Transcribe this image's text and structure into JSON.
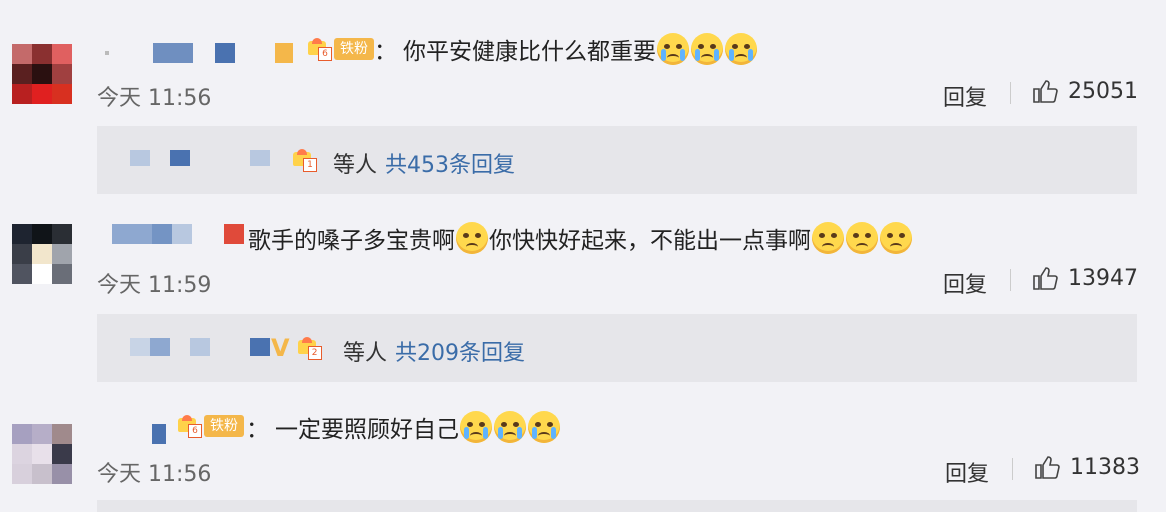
{
  "colors": {
    "link": "#3a6ca8",
    "badge": "#f4b74a",
    "bg": "#f2f2f6",
    "thread_bg": "#e6e6ea"
  },
  "comments": [
    {
      "badge_level": "6",
      "badge_label": "铁粉",
      "separator": "：",
      "text": "你平安健康比什么都重要",
      "emojis": [
        "cry-face",
        "cry-face",
        "cry-face"
      ],
      "time": "今天 11:56",
      "reply_label": "回复",
      "likes": "25051",
      "thread": {
        "badge_level": "1",
        "who": "等人",
        "summary": "共453条回复"
      }
    },
    {
      "text_a": "歌手的嗓子多宝贵啊",
      "text_b": "你快快好起来，不能出一点事啊",
      "emojis": [
        "pleading-face",
        "pleading-face",
        "pleading-face",
        "pleading-face"
      ],
      "time": "今天 11:59",
      "reply_label": "回复",
      "likes": "13947",
      "thread": {
        "badge_level": "2",
        "who": "等人",
        "summary": "共209条回复"
      }
    },
    {
      "badge_level": "6",
      "badge_label": "铁粉",
      "separator": "：",
      "text": "一定要照顾好自己",
      "emojis": [
        "sob-face",
        "sob-face",
        "sob-face"
      ],
      "time": "今天 11:56",
      "reply_label": "回复",
      "likes": "11383"
    }
  ]
}
